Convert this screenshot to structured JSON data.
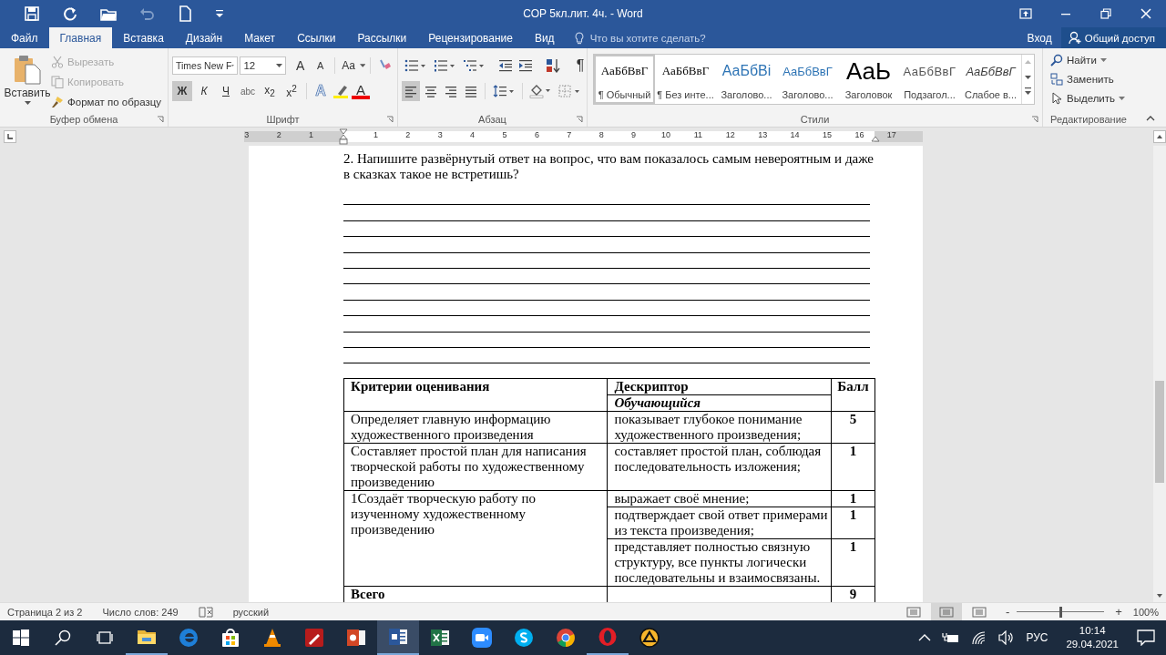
{
  "window": {
    "title": "СОР 5кл.лит. 4ч. - Word"
  },
  "quick_access": [
    {
      "disabled": false
    },
    {
      "disabled": false
    },
    {
      "disabled": false
    },
    {
      "disabled": true
    },
    {
      "disabled": false
    }
  ],
  "tabs": [
    {
      "label": "Файл",
      "selected": false
    },
    {
      "label": "Главная",
      "selected": true
    },
    {
      "label": "Вставка",
      "selected": false
    },
    {
      "label": "Дизайн",
      "selected": false
    },
    {
      "label": "Макет",
      "selected": false
    },
    {
      "label": "Ссылки",
      "selected": false
    },
    {
      "label": "Рассылки",
      "selected": false
    },
    {
      "label": "Рецензирование",
      "selected": false
    },
    {
      "label": "Вид",
      "selected": false
    }
  ],
  "tell_me": {
    "placeholder": "Что вы хотите сделать?"
  },
  "account": {
    "sign_in": "Вход",
    "share": "Общий доступ"
  },
  "clipboard": {
    "paste": "Вставить",
    "cut": {
      "label": "Вырезать",
      "disabled": true
    },
    "copy": {
      "label": "Копировать",
      "disabled": true
    },
    "format_painter": "Формат по образцу",
    "title": "Буфер обмена"
  },
  "font": {
    "name": "Times New F",
    "size": "12",
    "grow": "A",
    "shrink": "A",
    "change_case": "Aa",
    "buttons": [
      {
        "label": "Ж",
        "selected": true
      },
      {
        "label": "К",
        "selected": false
      },
      {
        "label": "Ч",
        "selected": false
      },
      {
        "label": "abc",
        "selected": false
      },
      {
        "label": "x$_{2}$",
        "selected": false
      },
      {
        "label": "x$^{2}$",
        "selected": false
      }
    ],
    "effects": "A",
    "font_color_button": "A",
    "title": "Шрифт"
  },
  "paragraph": {
    "alignment": [
      {
        "selected": true
      },
      {
        "selected": false
      },
      {
        "selected": false
      },
      {
        "selected": false
      }
    ],
    "pilcrow": "¶",
    "title": "Абзац"
  },
  "styles": {
    "items": [
      {
        "preview": "АаБбВвГ",
        "name": "¶ Обычный",
        "selected": true
      },
      {
        "preview": "АаБбВвГ",
        "name": "¶ Без инте...",
        "selected": false
      },
      {
        "preview": "АаБбВі",
        "name": "Заголово...",
        "selected": false
      },
      {
        "preview": "АаБбВвГ",
        "name": "Заголово...",
        "selected": false
      },
      {
        "preview": "АаЬ",
        "name": "Заголовок",
        "selected": false
      },
      {
        "preview": "АаБбВвГ",
        "name": "Подзагол...",
        "selected": false
      },
      {
        "preview": "АаБбВвГ",
        "name": "Слабое в...",
        "selected": false
      }
    ],
    "title": "Стили"
  },
  "editing": {
    "find": "Найти",
    "replace": "Заменить",
    "select": "Выделить",
    "title": "Редактирование"
  },
  "ruler": {
    "numbers": [
      "3",
      "2",
      "1",
      "1",
      "2",
      "3",
      "4",
      "5",
      "6",
      "7",
      "8",
      "9",
      "10",
      "11",
      "12",
      "13",
      "14",
      "15",
      "16",
      "17"
    ]
  },
  "document": {
    "question": "2. Напишите развёрнутый ответ на вопрос, что вам показалось самым невероятным и даже в сказках такое не встретишь?",
    "table": {
      "headers": {
        "criteria": "Критерии оценивания",
        "descriptor": "Дескриптор",
        "learner": "Обучающийся",
        "score": "Балл"
      },
      "rows": [
        {
          "criterion": "Определяет главную информацию художественного произведения",
          "descriptors": [
            {
              "text": "показывает глубокое понимание художественного произведения;",
              "score": "5"
            }
          ]
        },
        {
          "criterion": "Составляет простой план для написания творческой работы по художественному произведению",
          "descriptors": [
            {
              "text": "составляет простой план, соблюдая последовательность изложения;",
              "score": "1"
            }
          ]
        },
        {
          "criterion": "1Создаёт творческую работу по изученному художественному произведению",
          "descriptors": [
            {
              "text": "выражает своё мнение;",
              "score": "1"
            },
            {
              "text": "подтверждает свой ответ примерами из текста произведения;",
              "score": "1"
            },
            {
              "text": "представляет полностью связную структуру, все пункты логически последовательны и взаимосвязаны.",
              "score": "1"
            }
          ]
        }
      ],
      "total": {
        "label": "Всего",
        "score": "9"
      }
    }
  },
  "status_bar": {
    "page": "Страница 2 из 2",
    "words": "Число слов: 249",
    "language": "русский",
    "views": [
      {
        "selected": false
      },
      {
        "selected": true
      },
      {
        "selected": false
      }
    ],
    "zoom_out": "-",
    "zoom_in": "+",
    "zoom": {
      "level": 0.5,
      "reading": "100%"
    }
  },
  "taskbar": {
    "apps": [
      {
        "selected": false,
        "running": true
      },
      {
        "selected": false,
        "running": false
      },
      {
        "selected": false,
        "running": false
      },
      {
        "selected": false,
        "running": false
      },
      {
        "selected": false,
        "running": false
      },
      {
        "selected": false,
        "running": false
      },
      {
        "selected": true,
        "running": true
      },
      {
        "selected": false,
        "running": false
      },
      {
        "selected": false,
        "running": false
      },
      {
        "selected": false,
        "running": false
      },
      {
        "selected": false,
        "running": false
      },
      {
        "selected": false,
        "running": true
      },
      {
        "selected": false,
        "running": false
      }
    ],
    "language": "РУС",
    "time": "10:14",
    "date": "29.04.2021"
  }
}
